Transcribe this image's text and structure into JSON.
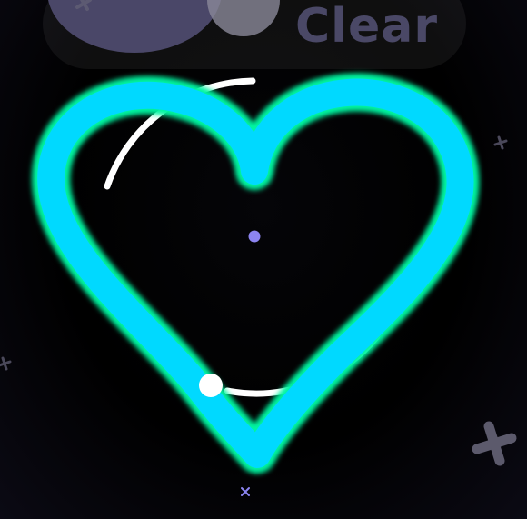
{
  "top_bar": {
    "clear_label": "Clear"
  },
  "colors": {
    "background": "#000000",
    "pill": "#1a1a22",
    "orb_large": "#4a4768",
    "orb_small": "#8a8898",
    "heart_core": "#00d9ff",
    "heart_glow": "#00f5a0",
    "guide_ring": "#ffffff",
    "center_dot": "#8c84f0",
    "cursor": "#ffffff",
    "sparkle": "#5c5a72"
  },
  "icons": [
    "plus-sparkle-icon",
    "x-sparkle-icon"
  ]
}
